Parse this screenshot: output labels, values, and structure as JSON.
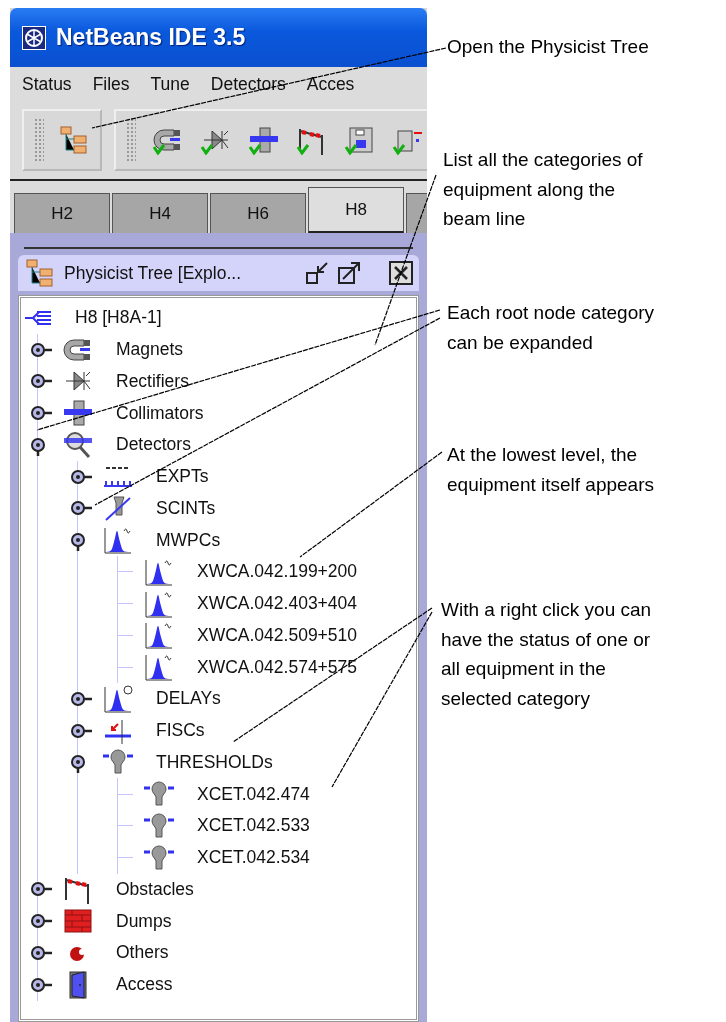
{
  "window": {
    "title": "NetBeans IDE 3.5"
  },
  "menu": [
    "Status",
    "Files",
    "Tune",
    "Detectors",
    "Acces"
  ],
  "tabs": [
    {
      "label": "H2",
      "selected": false
    },
    {
      "label": "H4",
      "selected": false
    },
    {
      "label": "H6",
      "selected": false
    },
    {
      "label": "H8",
      "selected": true
    }
  ],
  "panel": {
    "title": "Physicist Tree [Explo..."
  },
  "tree": {
    "label": "H8 [H8A-1]",
    "children": [
      {
        "label": "Magnets",
        "expanded": false
      },
      {
        "label": "Rectifiers",
        "expanded": false
      },
      {
        "label": "Collimators",
        "expanded": false
      },
      {
        "label": "Detectors",
        "expanded": true,
        "children": [
          {
            "label": "EXPTs",
            "expanded": false
          },
          {
            "label": "SCINTs",
            "expanded": false
          },
          {
            "label": "MWPCs",
            "expanded": true,
            "children": [
              {
                "label": "XWCA.042.199+200"
              },
              {
                "label": "XWCA.042.403+404"
              },
              {
                "label": "XWCA.042.509+510"
              },
              {
                "label": "XWCA.042.574+575"
              }
            ]
          },
          {
            "label": "DELAYs",
            "expanded": false
          },
          {
            "label": "FISCs",
            "expanded": false
          },
          {
            "label": "THRESHOLDs",
            "expanded": true,
            "children": [
              {
                "label": "XCET.042.474"
              },
              {
                "label": "XCET.042.533"
              },
              {
                "label": "XCET.042.534"
              }
            ]
          }
        ]
      },
      {
        "label": "Obstacles",
        "expanded": false
      },
      {
        "label": "Dumps",
        "expanded": false
      },
      {
        "label": "Others",
        "expanded": false
      },
      {
        "label": "Access",
        "expanded": false
      }
    ]
  },
  "annotations": [
    {
      "lines": [
        "Open the Physicist Tree"
      ]
    },
    {
      "lines": [
        "List all the categories of",
        "equipment along the",
        "beam line"
      ]
    },
    {
      "lines": [
        "Each root node category",
        "can be expanded"
      ]
    },
    {
      "lines": [
        "At the lowest level, the",
        "equipment itself appears"
      ]
    },
    {
      "lines": [
        "With a right click you can",
        "have the status of one or",
        "all equipment in the",
        "selected category"
      ]
    }
  ]
}
